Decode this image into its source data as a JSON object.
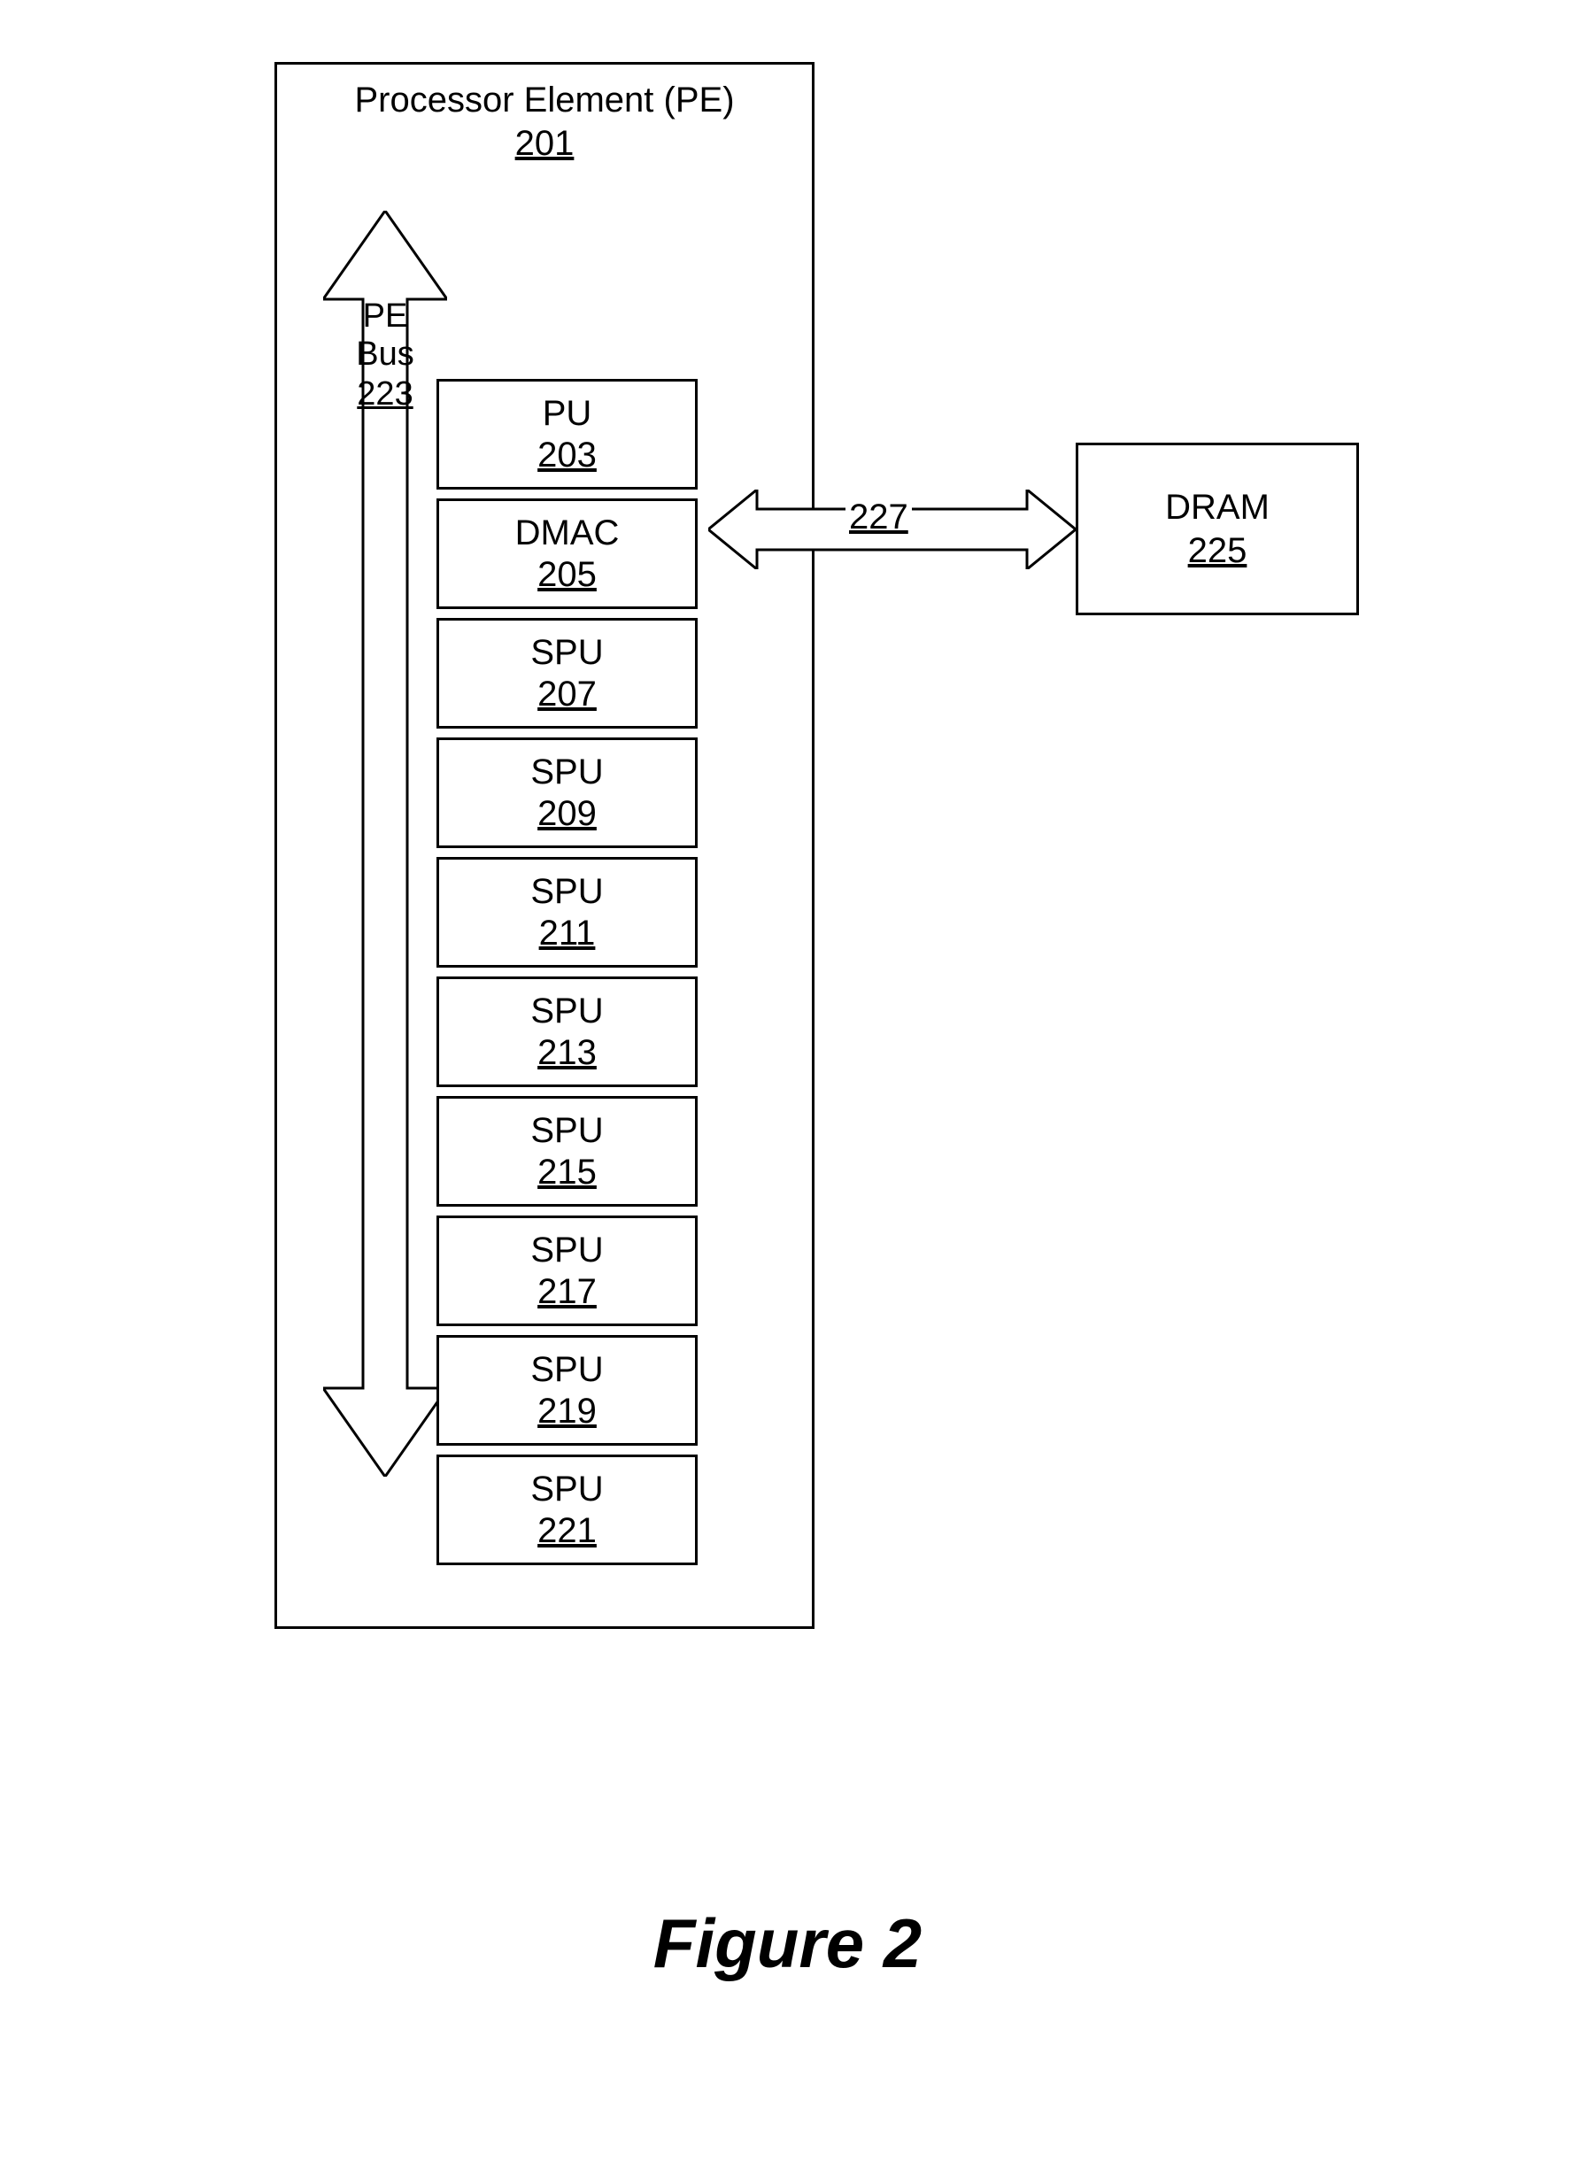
{
  "pe": {
    "title": "Processor Element (PE)",
    "ref": "201"
  },
  "bus": {
    "label": "PE Bus",
    "ref": "223"
  },
  "units": [
    {
      "label": "PU",
      "ref": "203"
    },
    {
      "label": "DMAC",
      "ref": "205"
    },
    {
      "label": "SPU",
      "ref": "207"
    },
    {
      "label": "SPU",
      "ref": "209"
    },
    {
      "label": "SPU",
      "ref": "211"
    },
    {
      "label": "SPU",
      "ref": "213"
    },
    {
      "label": "SPU",
      "ref": "215"
    },
    {
      "label": "SPU",
      "ref": "217"
    },
    {
      "label": "SPU",
      "ref": "219"
    },
    {
      "label": "SPU",
      "ref": "221"
    }
  ],
  "harrow": {
    "ref": "227"
  },
  "dram": {
    "label": "DRAM",
    "ref": "225"
  },
  "caption": "Figure 2"
}
